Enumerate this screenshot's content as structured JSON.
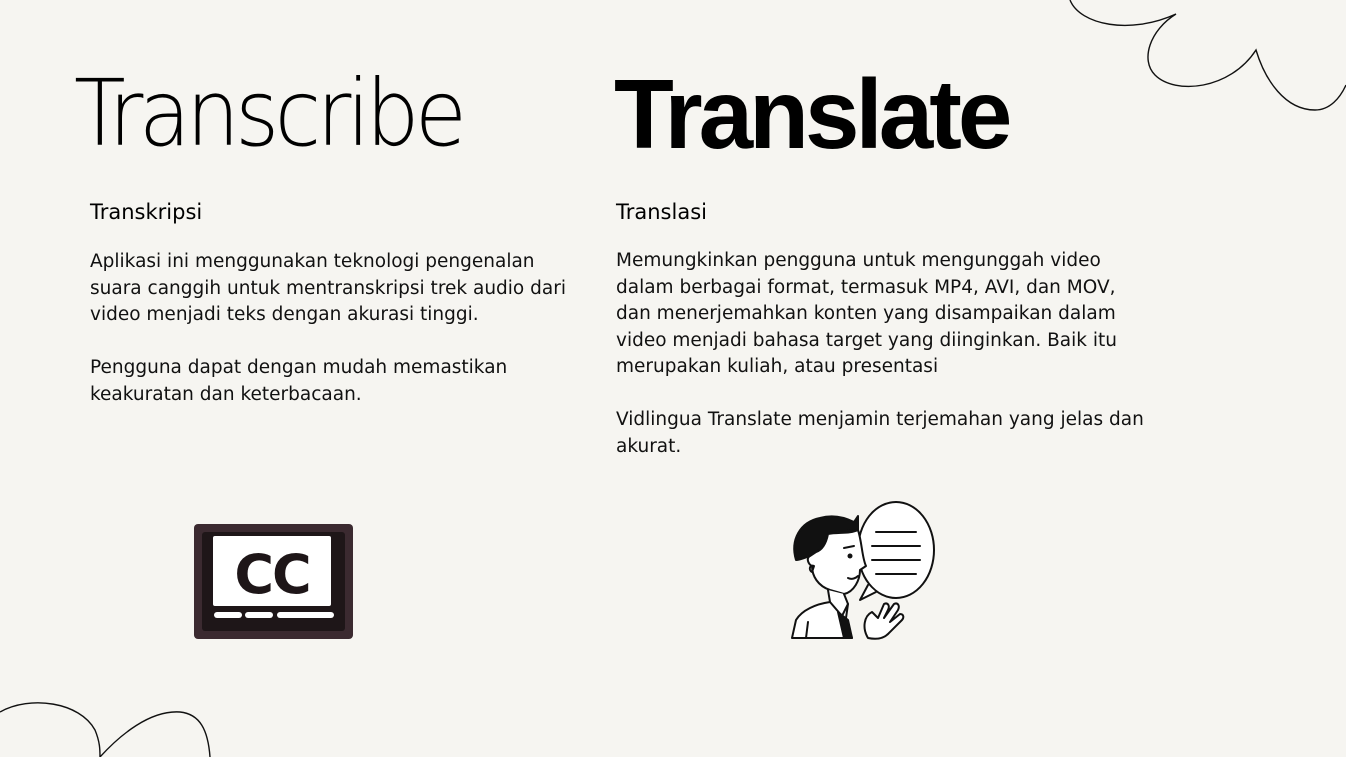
{
  "slide": {
    "left": {
      "title": "Transcribe",
      "subtitle": "Transkripsi",
      "paragraphs": [
        "Aplikasi ini menggunakan teknologi pengenalan suara canggih untuk mentranskripsi trek audio dari video menjadi teks dengan akurasi tinggi.",
        "Pengguna dapat dengan mudah memastikan keakuratan dan keterbacaan."
      ],
      "icon_label": "CC"
    },
    "right": {
      "title": "Translate",
      "subtitle": "Translasi",
      "paragraphs": [
        "Memungkinkan pengguna untuk mengunggah video dalam berbagai format, termasuk MP4, AVI, dan MOV, dan menerjemahkan konten yang disampaikan dalam video menjadi bahasa target yang diinginkan. Baik itu merupakan kuliah, atau presentasi",
        "Vidlingua Translate menjamin terjemahan yang jelas dan akurat."
      ]
    }
  },
  "colors": {
    "background": "#f6f5f1",
    "text": "#111111",
    "cc_frame": "#3b2a30"
  },
  "icons": [
    "closed-captions-icon",
    "speaking-person-icon",
    "scribble-decoration"
  ]
}
